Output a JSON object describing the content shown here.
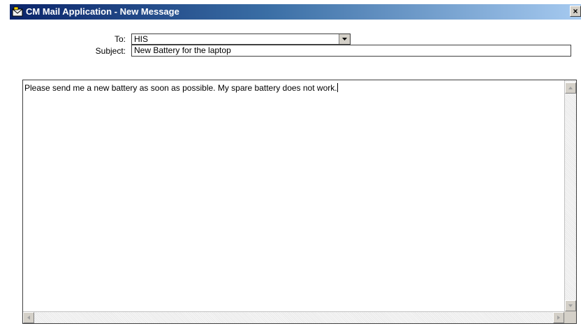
{
  "window": {
    "title": "CM Mail Application - New Message",
    "close_glyph": "×",
    "app_icon": "mail-app-icon",
    "colors": {
      "titlebar_start": "#0a246a",
      "titlebar_end": "#a6caf0",
      "face": "#d4d0c8"
    }
  },
  "form": {
    "to_label": "To:",
    "to_value": "HIS",
    "subject_label": "Subject:",
    "subject_value": "New Battery for the laptop"
  },
  "message": {
    "body": "Please send me a new battery as soon as possible.  My spare battery does not work."
  },
  "icons": {
    "dropdown": "chevron-down-icon",
    "scroll_up": "arrow-up-icon",
    "scroll_down": "arrow-down-icon",
    "scroll_left": "arrow-left-icon",
    "scroll_right": "arrow-right-icon"
  }
}
